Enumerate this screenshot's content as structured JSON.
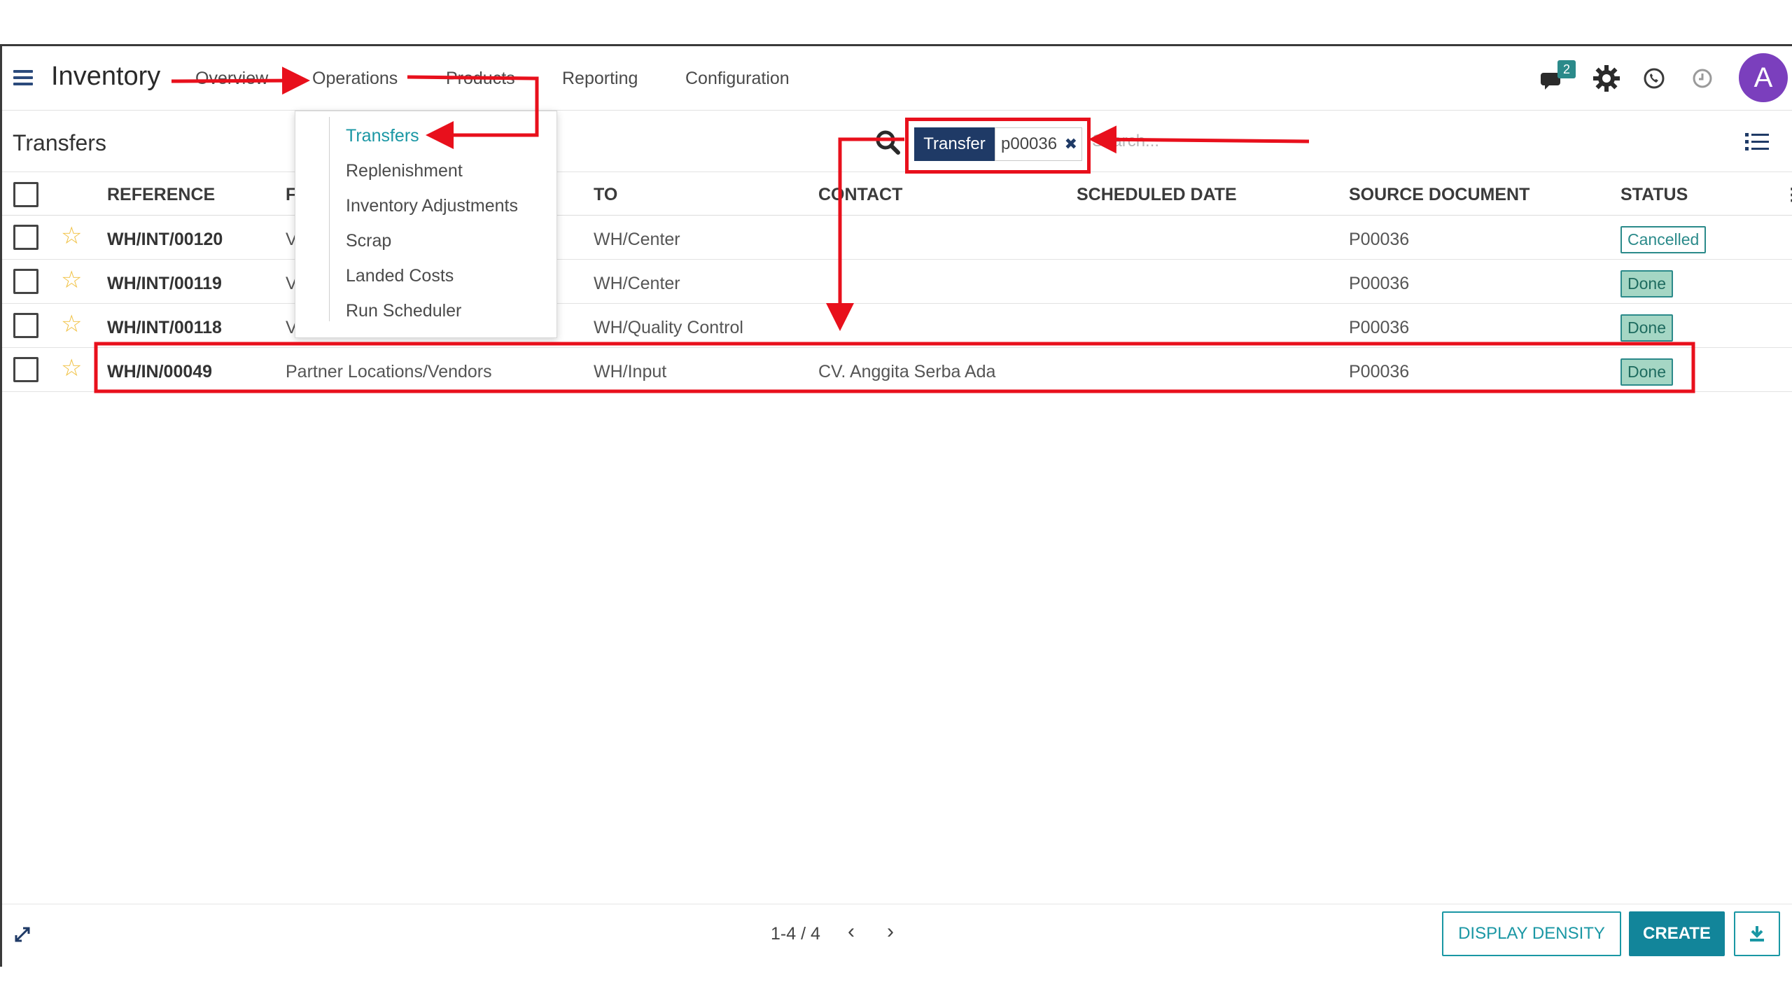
{
  "navbar": {
    "app_title": "Inventory",
    "menus": [
      "Overview",
      "Operations",
      "Products",
      "Reporting",
      "Configuration"
    ],
    "message_count": "2",
    "avatar_letter": "A"
  },
  "control": {
    "breadcrumb": "Transfers",
    "facet_label": "Transfer",
    "facet_value": "p00036",
    "search_placeholder": "Search..."
  },
  "dropdown": {
    "items": [
      "Transfers",
      "Replenishment",
      "Inventory Adjustments",
      "Scrap",
      "Landed Costs",
      "Run Scheduler"
    ]
  },
  "table": {
    "headers": [
      "REFERENCE",
      "F",
      "TO",
      "CONTACT",
      "SCHEDULED DATE",
      "SOURCE DOCUMENT",
      "STATUS"
    ],
    "rows": [
      {
        "reference": "WH/INT/00120",
        "from": "V",
        "to": "WH/Center",
        "contact": "",
        "scheduled": "",
        "source": "P00036",
        "status": "Cancelled"
      },
      {
        "reference": "WH/INT/00119",
        "from": "V",
        "to": "WH/Center",
        "contact": "",
        "scheduled": "",
        "source": "P00036",
        "status": "Done"
      },
      {
        "reference": "WH/INT/00118",
        "from": "V",
        "to": "WH/Quality Control",
        "contact": "",
        "scheduled": "",
        "source": "P00036",
        "status": "Done"
      },
      {
        "reference": "WH/IN/00049",
        "from": "Partner Locations/Vendors",
        "to": "WH/Input",
        "contact": "CV. Anggita Serba Ada",
        "scheduled": "",
        "source": "P00036",
        "status": "Done"
      }
    ]
  },
  "footer": {
    "pager": "1-4 / 4",
    "display_density": "DISPLAY DENSITY",
    "create": "CREATE"
  },
  "colors": {
    "accent": "#1a97a4",
    "facet_bg": "#1f3a66",
    "annotation_red": "#e8101c",
    "avatar": "#7b3fbd",
    "done_bg": "#a5d6c4"
  }
}
